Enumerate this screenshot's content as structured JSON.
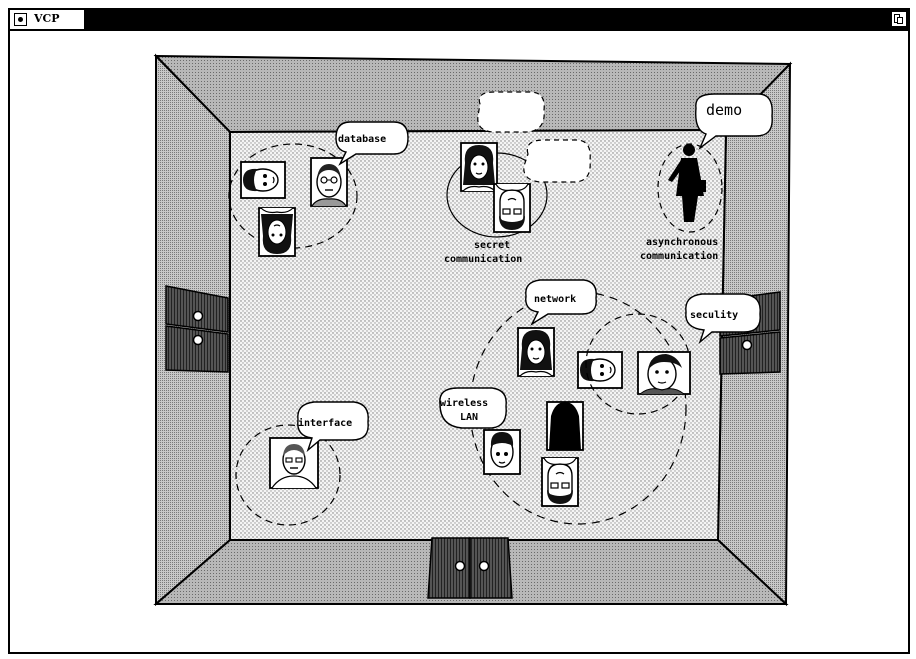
{
  "window": {
    "title": "VCP"
  },
  "room": {
    "groups": [
      {
        "id": "database",
        "label": "database"
      },
      {
        "id": "secret",
        "label_line1": "secret",
        "label_line2": "communication"
      },
      {
        "id": "async",
        "bubble": "demo",
        "label_line1": "asynchronous",
        "label_line2": "communication"
      },
      {
        "id": "network",
        "label": "network"
      },
      {
        "id": "security",
        "label": "seculity"
      },
      {
        "id": "wireless",
        "label_line1": "wireless",
        "label_line2": "LAN"
      },
      {
        "id": "interface",
        "label": "interface"
      }
    ]
  }
}
